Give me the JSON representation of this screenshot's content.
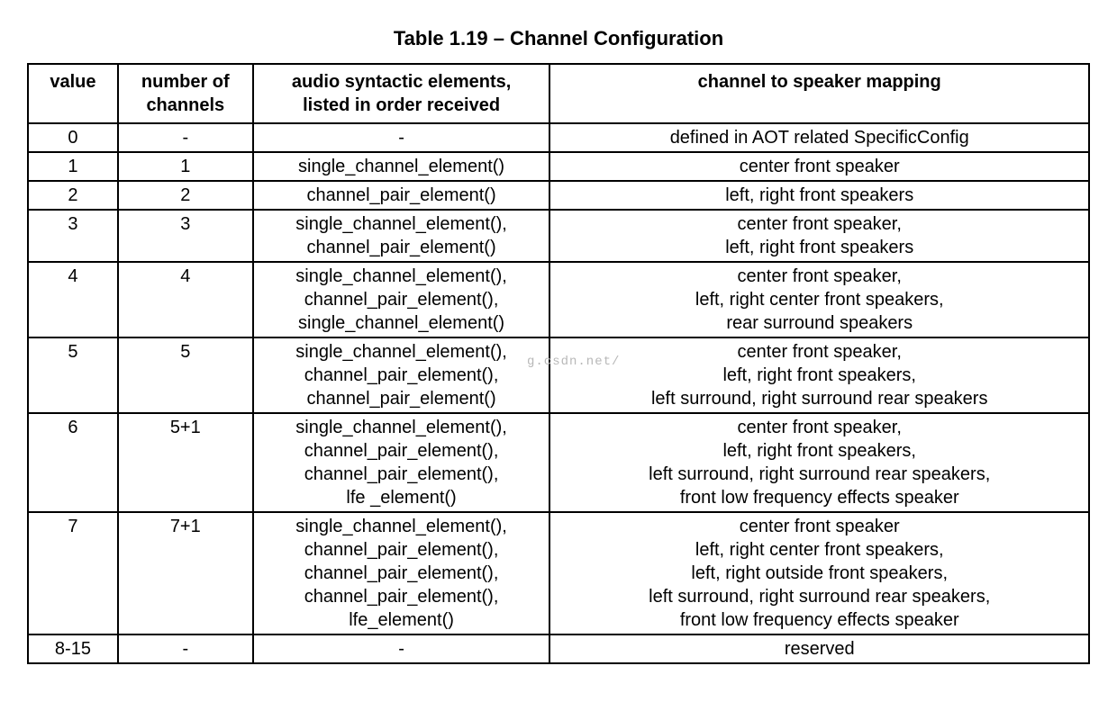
{
  "title": "Table 1.19 – Channel Configuration",
  "headers": {
    "c1": "value",
    "c2": "number of\nchannels",
    "c3": "audio syntactic elements,\nlisted in order received",
    "c4": "channel to speaker mapping"
  },
  "rows": [
    {
      "value": "0",
      "channels": "-",
      "elements": "-",
      "mapping": "defined in AOT related SpecificConfig"
    },
    {
      "value": "1",
      "channels": "1",
      "elements": "single_channel_element()",
      "mapping": "center front speaker"
    },
    {
      "value": "2",
      "channels": "2",
      "elements": "channel_pair_element()",
      "mapping": "left, right front speakers"
    },
    {
      "value": "3",
      "channels": "3",
      "elements": "single_channel_element(),\nchannel_pair_element()",
      "mapping": "center front speaker,\nleft, right front speakers"
    },
    {
      "value": "4",
      "channels": "4",
      "elements": "single_channel_element(),\nchannel_pair_element(),\nsingle_channel_element()",
      "mapping": "center front speaker,\nleft, right center front speakers,\nrear surround speakers"
    },
    {
      "value": "5",
      "channels": "5",
      "elements": "single_channel_element(),\nchannel_pair_element(),\nchannel_pair_element()",
      "mapping": "center front speaker,\nleft, right front speakers,\nleft surround, right surround rear speakers"
    },
    {
      "value": "6",
      "channels": "5+1",
      "elements": "single_channel_element(),\nchannel_pair_element(),\nchannel_pair_element(),\nlfe _element()",
      "mapping": "center front speaker,\nleft, right front speakers,\nleft surround, right surround rear speakers,\nfront low frequency effects speaker"
    },
    {
      "value": "7",
      "channels": "7+1",
      "elements": "single_channel_element(),\nchannel_pair_element(),\nchannel_pair_element(),\nchannel_pair_element(),\nlfe_element()",
      "mapping": "center front speaker\nleft, right center front speakers,\nleft, right outside front speakers,\nleft surround, right surround rear speakers,\nfront low frequency effects speaker"
    },
    {
      "value": "8-15",
      "channels": "-",
      "elements": "-",
      "mapping": "reserved"
    }
  ],
  "watermark": "g.csdn.net/"
}
